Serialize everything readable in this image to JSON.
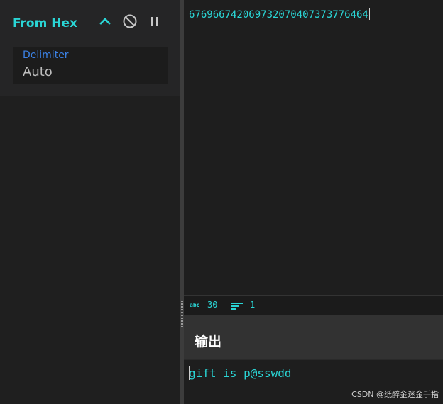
{
  "operation": {
    "title": "From Hex",
    "delimiter_label": "Delimiter",
    "delimiter_value": "Auto"
  },
  "input": {
    "text": "676966742069732070407373776464"
  },
  "stats": {
    "length": "30",
    "lines": "1"
  },
  "output": {
    "title": "输出",
    "text": "gift is p@sswdd"
  },
  "watermark": "CSDN @纸醉金迷金手指",
  "colors": {
    "accent": "#2ad5d5",
    "label_blue": "#3b82e6",
    "background": "#1e1e1e",
    "panel": "#252526"
  },
  "icons": [
    "chevron-up-icon",
    "disable-icon",
    "pause-icon",
    "abc-icon",
    "lines-icon"
  ]
}
